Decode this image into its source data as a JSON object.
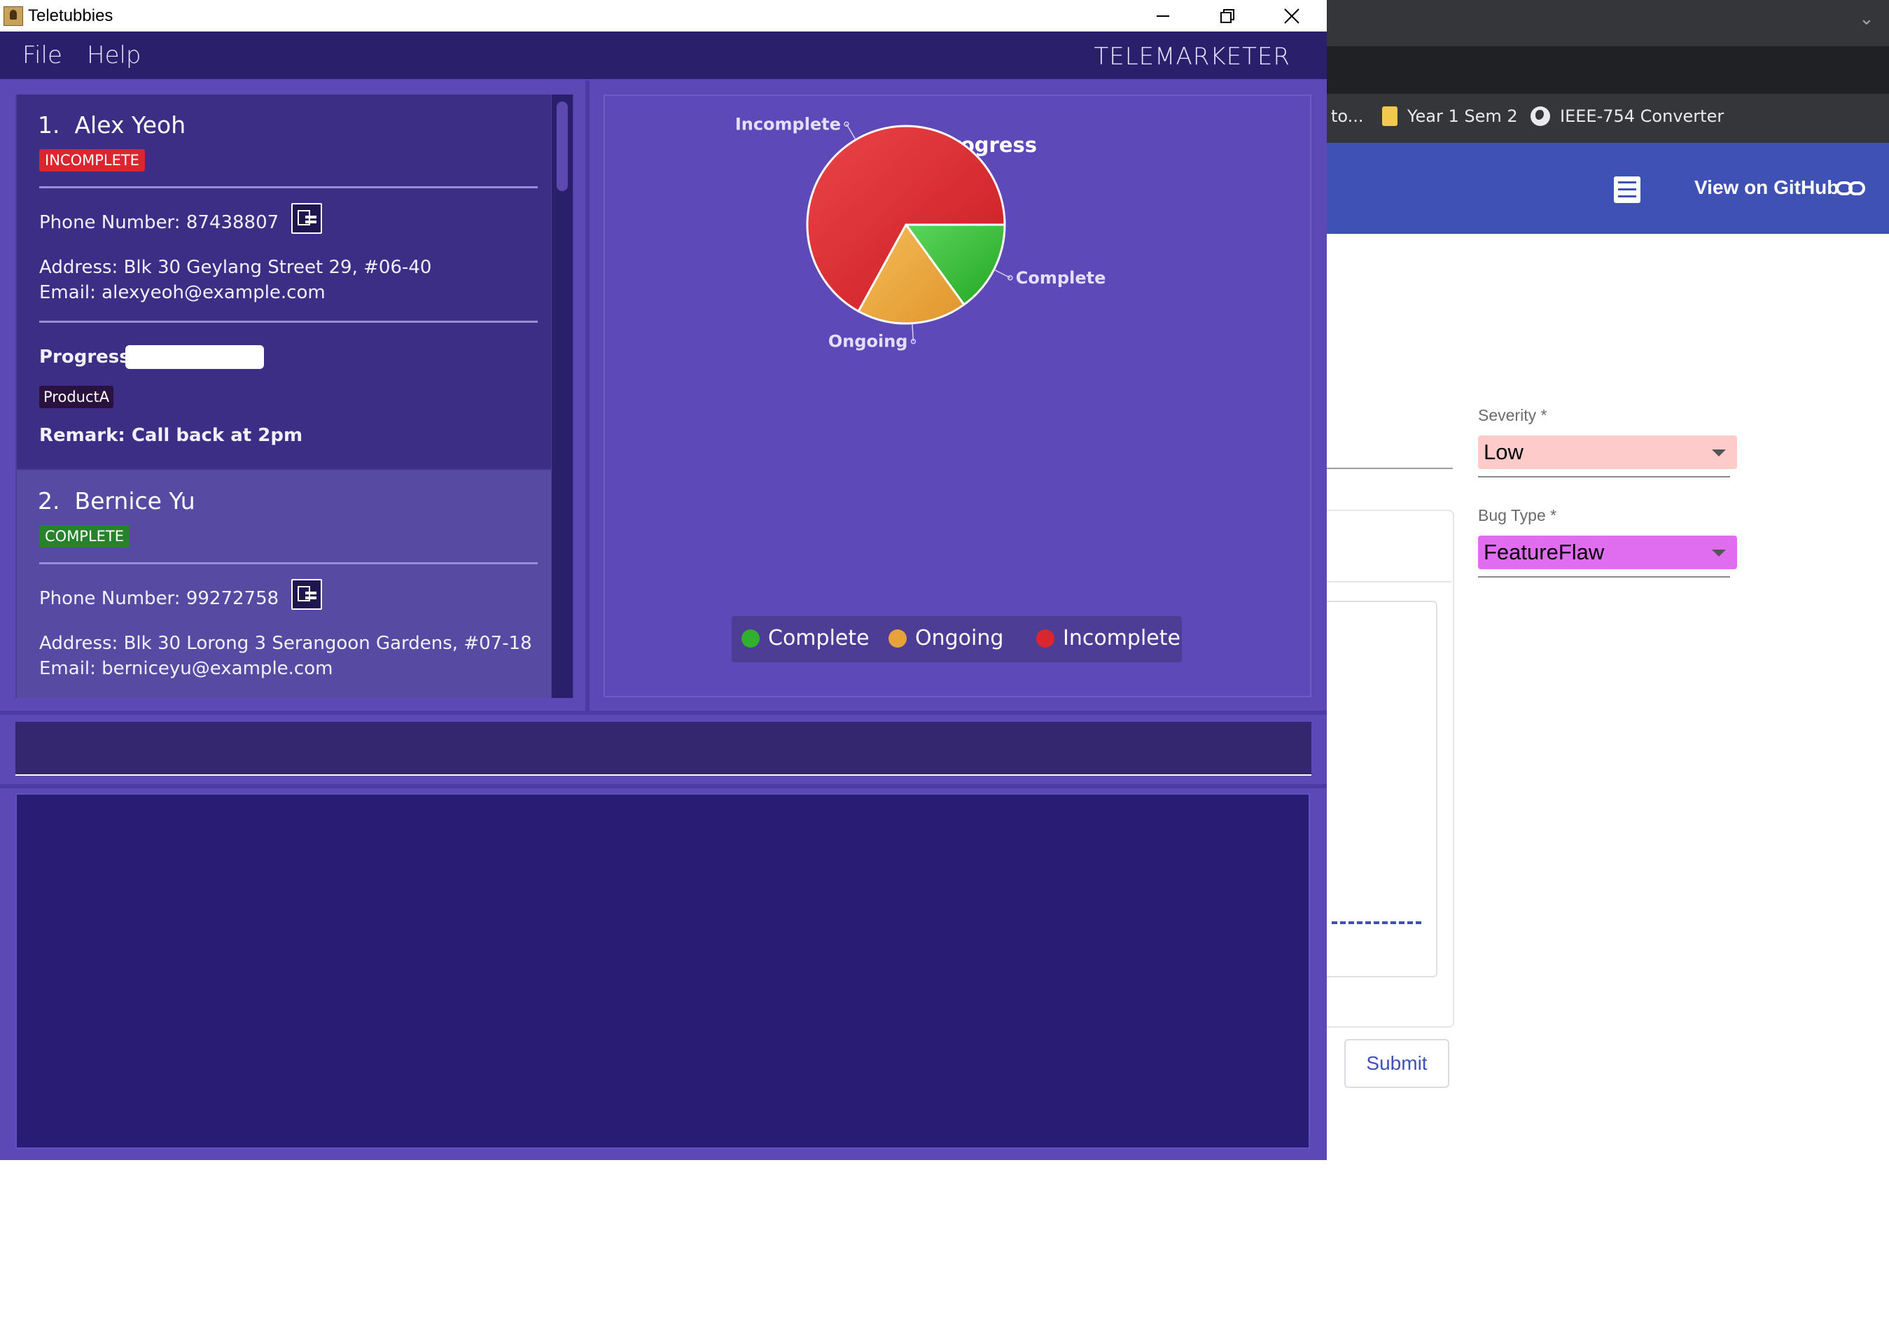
{
  "window": {
    "title": "Teletubbies",
    "controls": [
      "minimize",
      "restore",
      "close"
    ]
  },
  "menu": {
    "file": "File",
    "help": "Help",
    "brand": "TELEMARKETER"
  },
  "contacts": [
    {
      "index": "1.",
      "name": "Alex Yeoh",
      "status": "INCOMPLETE",
      "phone": "Phone Number: 87438807",
      "address": "Address: Blk 30 Geylang Street 29, #06-40",
      "email": "Email: alexyeoh@example.com",
      "progress_label": "Progress:",
      "progress_value": 0,
      "tag": "ProductA",
      "remark": "Remark: Call back at 2pm"
    },
    {
      "index": "2.",
      "name": "Bernice Yu",
      "status": "COMPLETE",
      "phone": "Phone Number: 99272758",
      "address": "Address: Blk 30 Lorong 3 Serangoon Gardens, #07-18",
      "email": "Email: berniceyu@example.com"
    }
  ],
  "chart_data": {
    "type": "pie",
    "title": "Your Progress",
    "slices": [
      {
        "label": "Complete",
        "value": 15,
        "color": "#2fb12f"
      },
      {
        "label": "Ongoing",
        "value": 18,
        "color": "#e8a23a"
      },
      {
        "label": "Incomplete",
        "value": 67,
        "color": "#d9262f"
      }
    ],
    "legend": [
      "Complete",
      "Ongoing",
      "Incomplete"
    ],
    "legend_position": "bottom"
  },
  "command": {
    "value": ""
  },
  "result": {
    "text": ""
  },
  "browser": {
    "bookmarks": [
      "to...",
      "Year 1 Sem 2",
      "IEEE-754 Converter"
    ],
    "github_link": "View on GitHub",
    "severity_label": "Severity *",
    "severity_value": "Low",
    "severity_color": "#fecbcb",
    "bug_type_label": "Bug Type *",
    "bug_type_value": "FeatureFlaw",
    "bug_type_color": "#e06cf0",
    "submit": "Submit"
  }
}
